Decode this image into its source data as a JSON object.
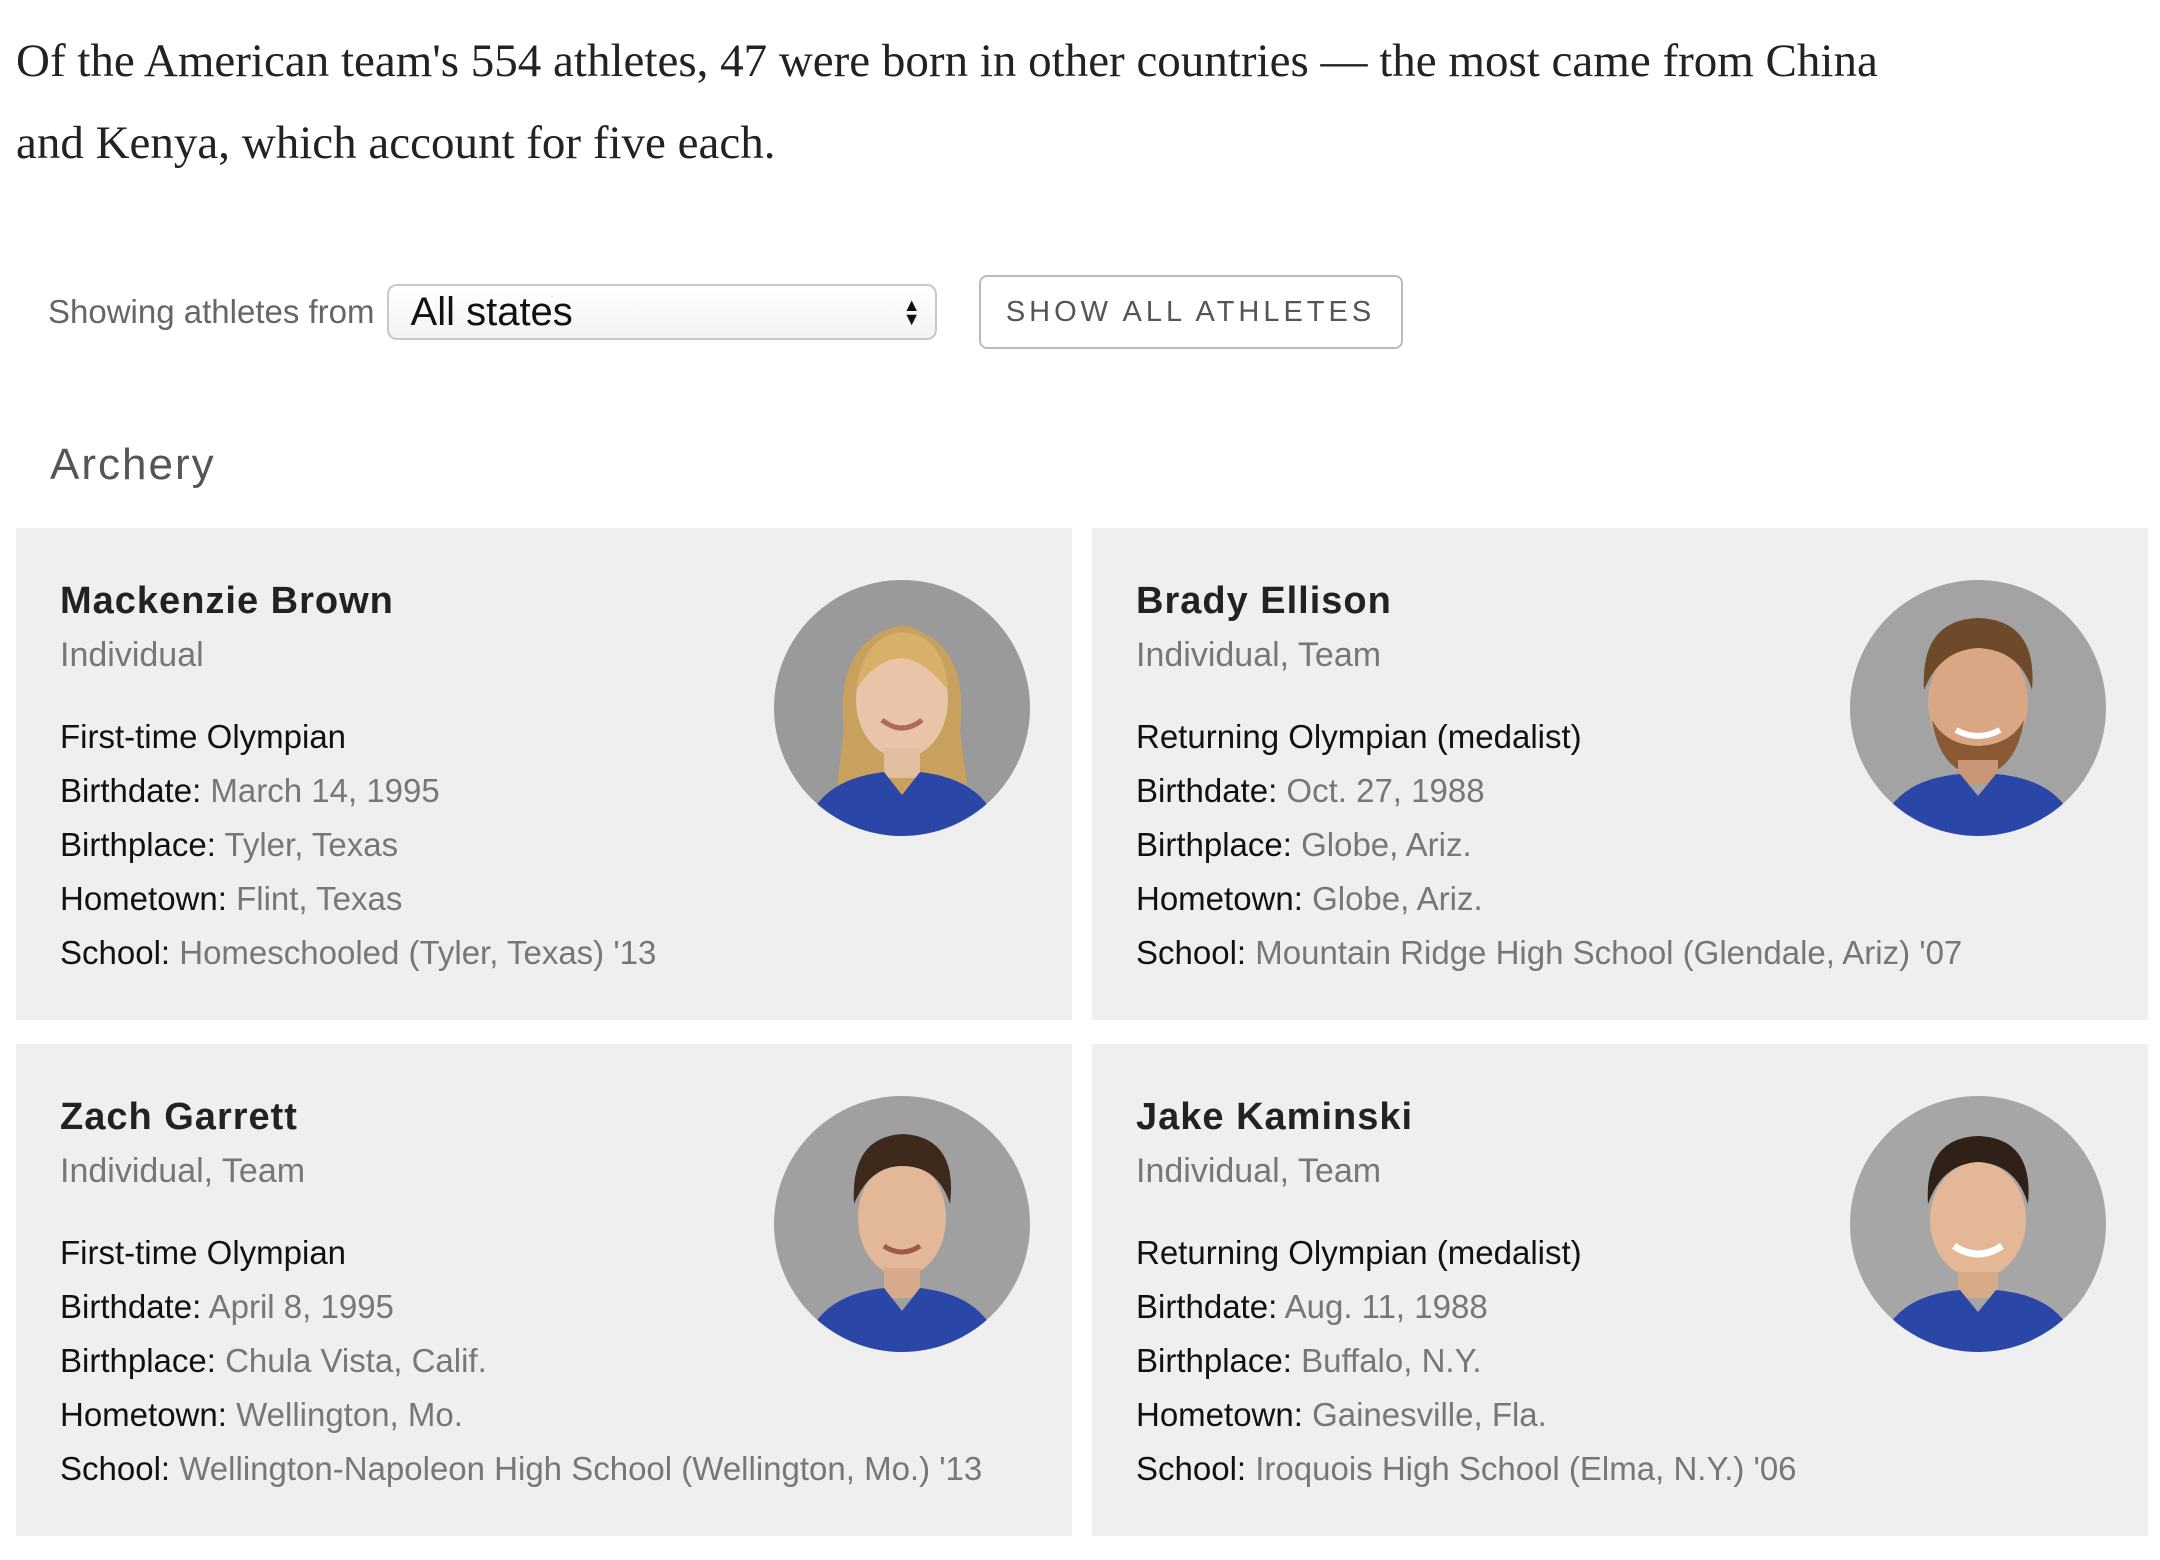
{
  "intro": {
    "text": "Of the American team's 554 athletes, 47 were born in other countries — the most came from China and Kenya, which account for five each."
  },
  "filter": {
    "label": "Showing athletes from",
    "selected": "All states",
    "show_all_label": "SHOW ALL ATHLETES"
  },
  "section": {
    "title": "Archery"
  },
  "field_labels": {
    "birthdate": "Birthdate:",
    "birthplace": "Birthplace:",
    "hometown": "Hometown:",
    "school": "School:"
  },
  "athletes": [
    {
      "name": "Mackenzie Brown",
      "events": "Individual",
      "status": "First-time Olympian",
      "birthdate": "March 14, 1995",
      "birthplace": "Tyler, Texas",
      "hometown": "Flint, Texas",
      "school": "Homeschooled (Tyler, Texas) '13"
    },
    {
      "name": "Brady Ellison",
      "events": "Individual, Team",
      "status": "Returning Olympian (medalist)",
      "birthdate": "Oct. 27, 1988",
      "birthplace": "Globe, Ariz.",
      "hometown": "Globe, Ariz.",
      "school": "Mountain Ridge High School (Glendale, Ariz) '07"
    },
    {
      "name": "Zach Garrett",
      "events": "Individual, Team",
      "status": "First-time Olympian",
      "birthdate": "April 8, 1995",
      "birthplace": "Chula Vista, Calif.",
      "hometown": "Wellington, Mo.",
      "school": "Wellington-Napoleon High School (Wellington, Mo.) '13"
    },
    {
      "name": "Jake Kaminski",
      "events": "Individual, Team",
      "status": "Returning Olympian (medalist)",
      "birthdate": "Aug. 11, 1988",
      "birthplace": "Buffalo, N.Y.",
      "hometown": "Gainesville, Fla.",
      "school": "Iroquois High School (Elma, N.Y.) '06"
    }
  ]
}
